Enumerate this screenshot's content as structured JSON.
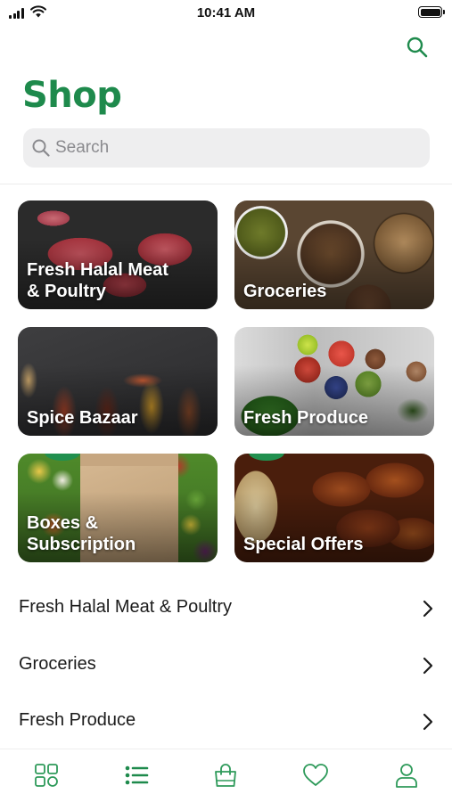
{
  "status_bar": {
    "time": "10:41 AM"
  },
  "header": {
    "title": "Shop",
    "search_button_icon": "search-icon"
  },
  "search": {
    "placeholder": "Search"
  },
  "category_tiles": [
    {
      "label": "Fresh Halal Meat\n& Poultry"
    },
    {
      "label": "Groceries"
    },
    {
      "label": "Spice Bazaar"
    },
    {
      "label": "Fresh Produce"
    },
    {
      "label": "Boxes &\nSubscription"
    },
    {
      "label": "Special Offers"
    }
  ],
  "category_list": [
    {
      "label": "Fresh Halal Meat & Poultry"
    },
    {
      "label": "Groceries"
    },
    {
      "label": "Fresh Produce"
    }
  ],
  "tab_bar": {
    "tabs": [
      {
        "icon": "grid-icon",
        "active": false
      },
      {
        "icon": "list-icon",
        "active": true
      },
      {
        "icon": "shopping-bag-icon",
        "active": false
      },
      {
        "icon": "heart-icon",
        "active": false
      },
      {
        "icon": "user-icon",
        "active": false
      }
    ]
  },
  "colors": {
    "accent": "#1e8a4c",
    "search_bg": "#eeeeef",
    "tab_icon": "#2e9a5a"
  }
}
